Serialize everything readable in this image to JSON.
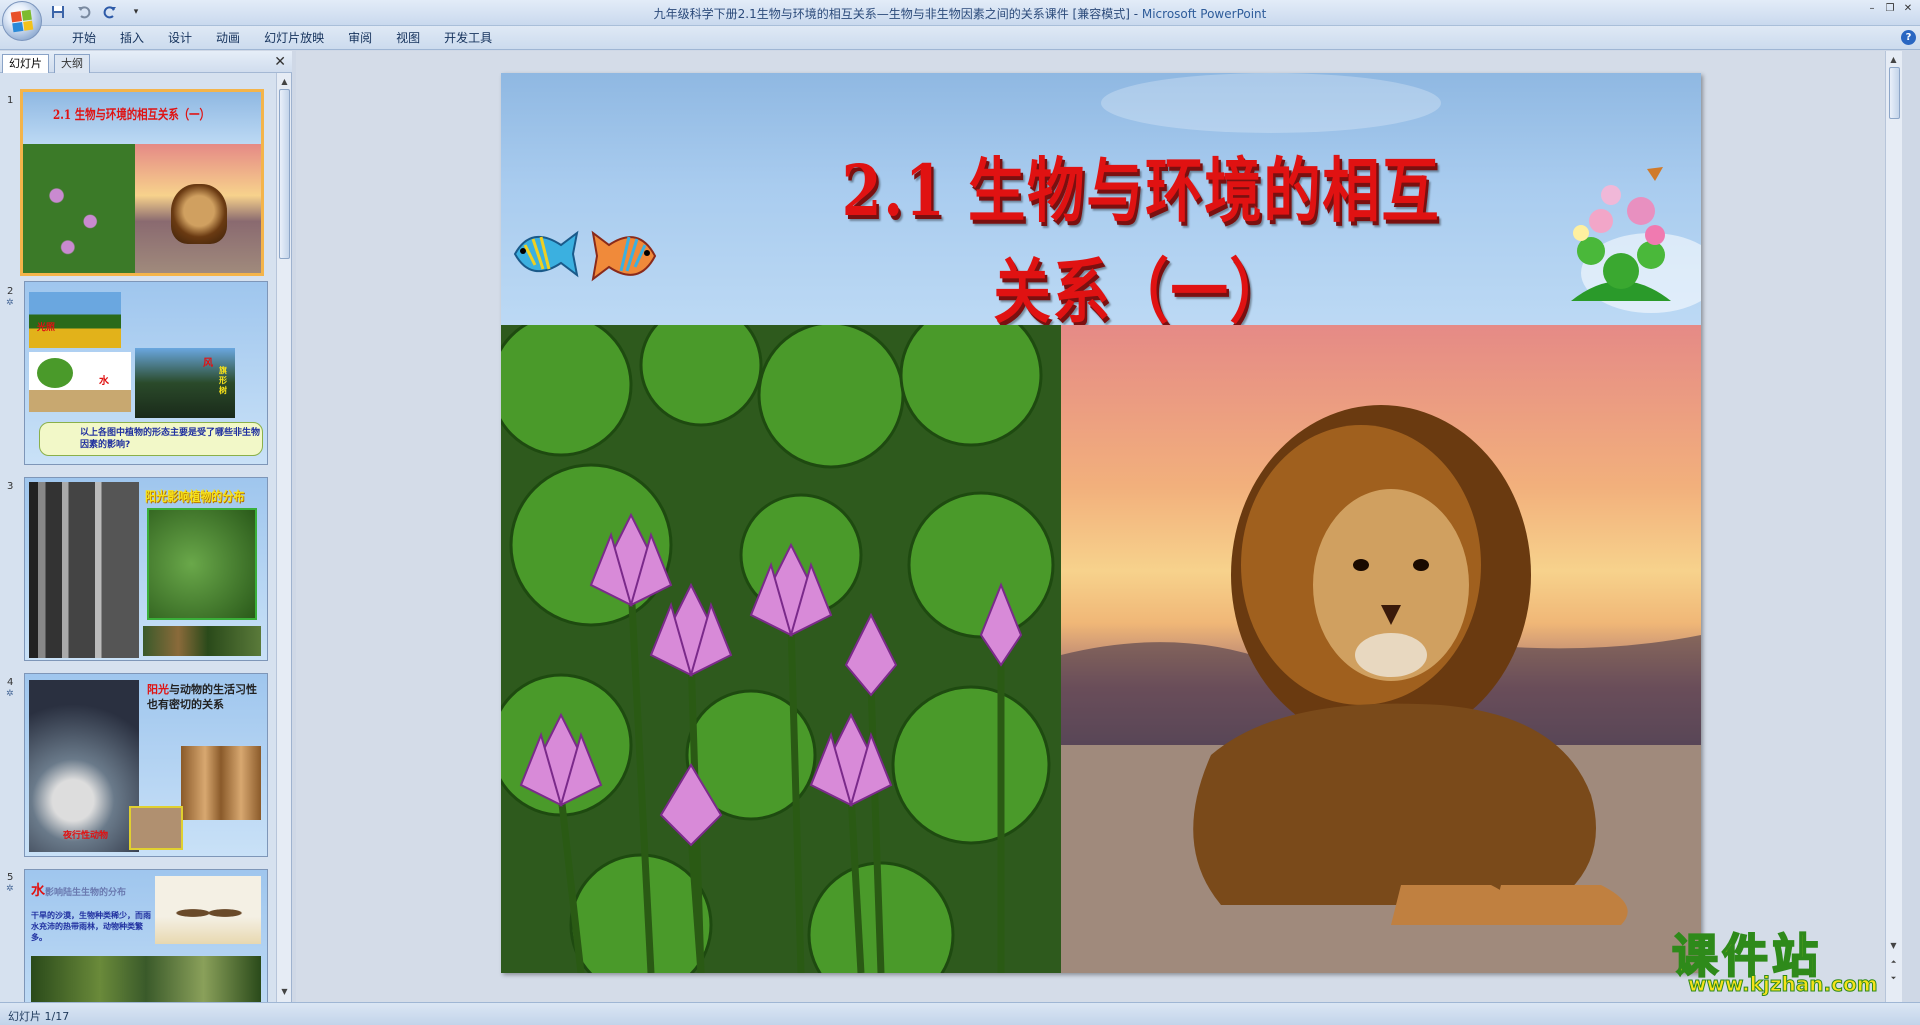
{
  "window": {
    "title_doc": "九年级科学下册2.1生物与环境的相互关系—生物与非生物因素之间的关系课件 [兼容模式]",
    "title_sep": " - ",
    "title_app": "Microsoft PowerPoint"
  },
  "ribbon": {
    "tabs": [
      "开始",
      "插入",
      "设计",
      "动画",
      "幻灯片放映",
      "审阅",
      "视图",
      "开发工具"
    ]
  },
  "pane": {
    "tab_slides": "幻灯片",
    "tab_outline": "大纲"
  },
  "thumbnails": [
    {
      "num": "1",
      "title": "2.1 生物与环境的相互关系（一）"
    },
    {
      "num": "2",
      "label_sun": "光照",
      "label_water": "水",
      "label_wind": "风",
      "label_wind2": "旗形树",
      "question": "以上各图中植物的形态主要是受了哪些非生物因素的影响?"
    },
    {
      "num": "3",
      "title": "阳光影响植物的分布"
    },
    {
      "num": "4",
      "text_highlight": "阳光",
      "text": "与动物的生活习性也有密切的关系",
      "caption": "夜行性动物"
    },
    {
      "num": "5",
      "title_char": "水",
      "title_rest": "影响陆生生物的分布",
      "body": "干旱的沙漠，生物种类稀少，而雨水充沛的热带雨林，动物种类繁多。"
    }
  ],
  "slide": {
    "title": "2.1 生物与环境的相互关系（一）"
  },
  "status": {
    "slide_info": "幻灯片 1/17"
  },
  "watermark": {
    "name": "课件站",
    "url": "www.kjzhan.com"
  }
}
